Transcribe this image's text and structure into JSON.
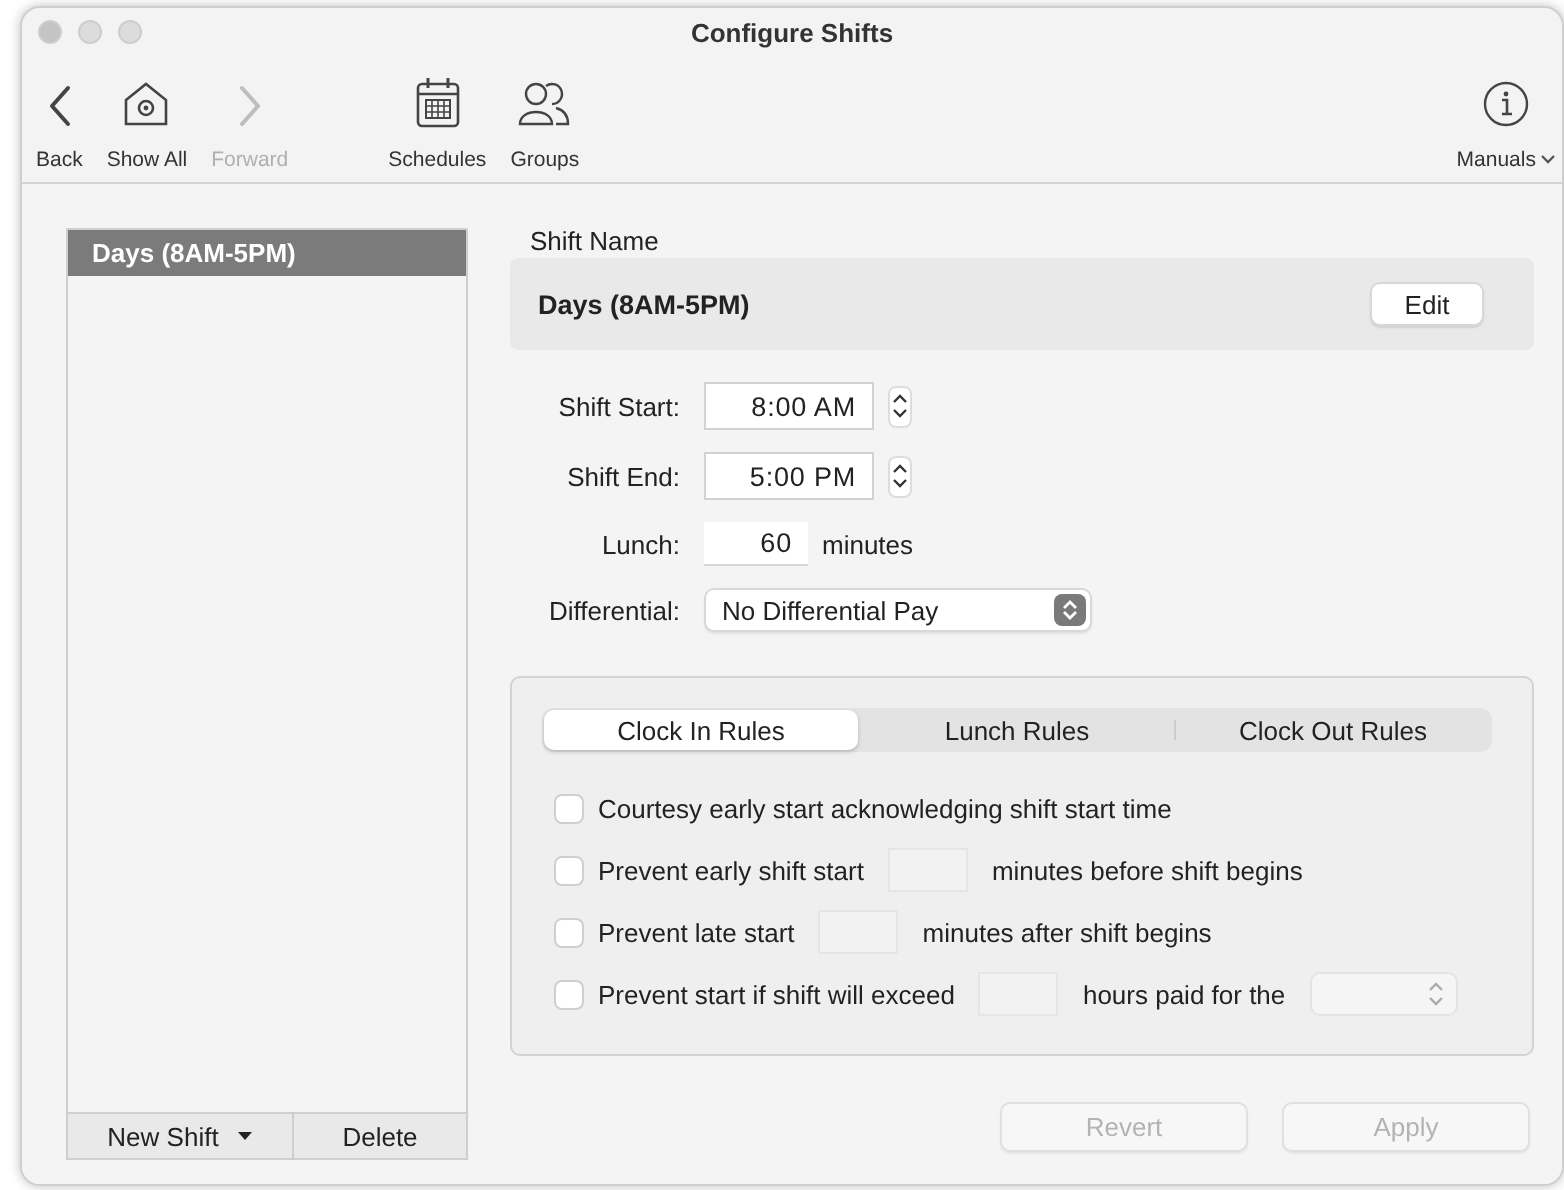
{
  "window": {
    "title": "Configure Shifts"
  },
  "toolbar": {
    "navigation": [
      {
        "label": "Back",
        "kind": "back",
        "disabled": false
      },
      {
        "label": "Show All",
        "kind": "home",
        "disabled": false
      },
      {
        "label": "Forward",
        "kind": "forward",
        "disabled": true
      }
    ],
    "tools": [
      {
        "label": "Schedules",
        "kind": "calendar",
        "disabled": false
      },
      {
        "label": "Groups",
        "kind": "people",
        "disabled": false
      }
    ],
    "help": [
      {
        "label": "Manuals",
        "kind": "info",
        "disabled": false,
        "menu": true
      }
    ]
  },
  "shift_list": {
    "items": [
      {
        "label": "Days (8AM-5PM)",
        "selected": true
      }
    ],
    "buttons": [
      {
        "label": "New Shift",
        "menu": true
      },
      {
        "label": "Delete",
        "menu": false
      }
    ]
  },
  "shift_name": {
    "label": "Shift Name",
    "value": "Days (8AM-5PM)",
    "button": "Edit"
  },
  "fields": [
    {
      "label": "Shift Start:",
      "kind": "time",
      "value": "8:00 AM"
    },
    {
      "label": "Shift End:",
      "kind": "time",
      "value": "5:00 PM"
    },
    {
      "label": "Lunch:",
      "kind": "number",
      "value": "60",
      "unit": "minutes"
    },
    {
      "label": "Differential:",
      "kind": "select",
      "value": "No Differential Pay"
    }
  ],
  "rules": {
    "tabs": [
      {
        "label": "Clock In Rules",
        "selected": true
      },
      {
        "label": "Lunch Rules",
        "selected": false
      },
      {
        "label": "Clock Out Rules",
        "selected": false
      }
    ],
    "rows": [
      {
        "checked": false,
        "parts": [
          {
            "kind": "text",
            "text": "Courtesy early start acknowledging shift start time"
          }
        ]
      },
      {
        "checked": false,
        "parts": [
          {
            "kind": "text",
            "text": "Prevent early shift start"
          },
          {
            "kind": "input"
          },
          {
            "kind": "text",
            "text": "minutes before shift begins"
          }
        ]
      },
      {
        "checked": false,
        "parts": [
          {
            "kind": "text",
            "text": "Prevent late start"
          },
          {
            "kind": "input"
          },
          {
            "kind": "text",
            "text": "minutes after shift begins"
          }
        ]
      },
      {
        "checked": false,
        "parts": [
          {
            "kind": "text",
            "text": "Prevent start if shift will exceed"
          },
          {
            "kind": "input"
          },
          {
            "kind": "text",
            "text": "hours paid for the"
          },
          {
            "kind": "select"
          }
        ]
      }
    ]
  },
  "actions": [
    {
      "label": "Revert",
      "disabled": true
    },
    {
      "label": "Apply",
      "disabled": true
    }
  ]
}
